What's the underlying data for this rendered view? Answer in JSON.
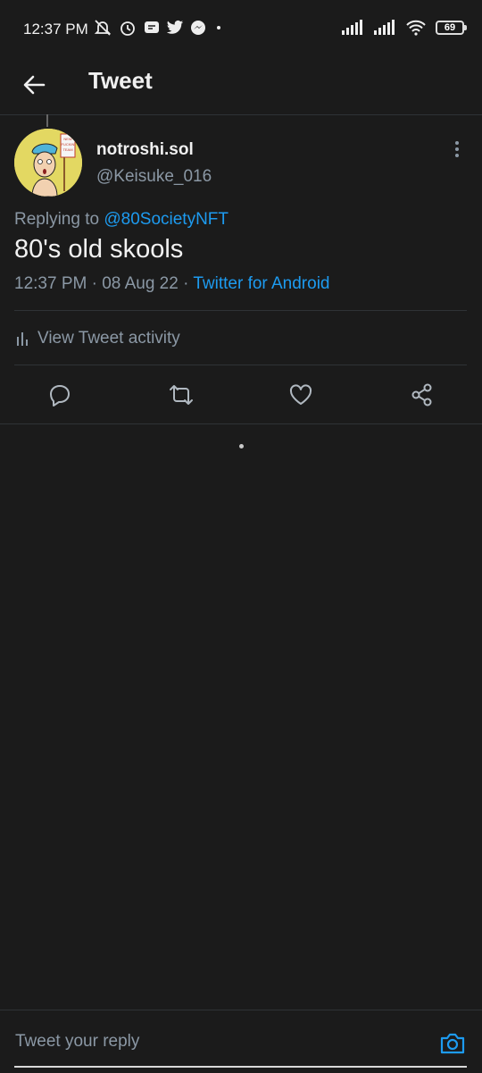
{
  "status": {
    "time": "12:37 PM",
    "battery": "69"
  },
  "header": {
    "title": "Tweet"
  },
  "tweet": {
    "display_name": "notroshi.sol",
    "handle": "@Keisuke_016",
    "replying_prefix": "Replying to ",
    "replying_to": "@80SocietyNFT",
    "text": "80's old skools",
    "time": "12:37 PM",
    "separator": " · ",
    "date": "08 Aug 22",
    "source": "Twitter for Android",
    "avatar_sign": "NEW FUCKIN TEAM"
  },
  "activity": {
    "label": "View Tweet activity"
  },
  "reply": {
    "placeholder": "Tweet your reply"
  },
  "colors": {
    "background": "#1b1b1b",
    "accent": "#1d9bf0",
    "muted": "#8b98a5"
  }
}
